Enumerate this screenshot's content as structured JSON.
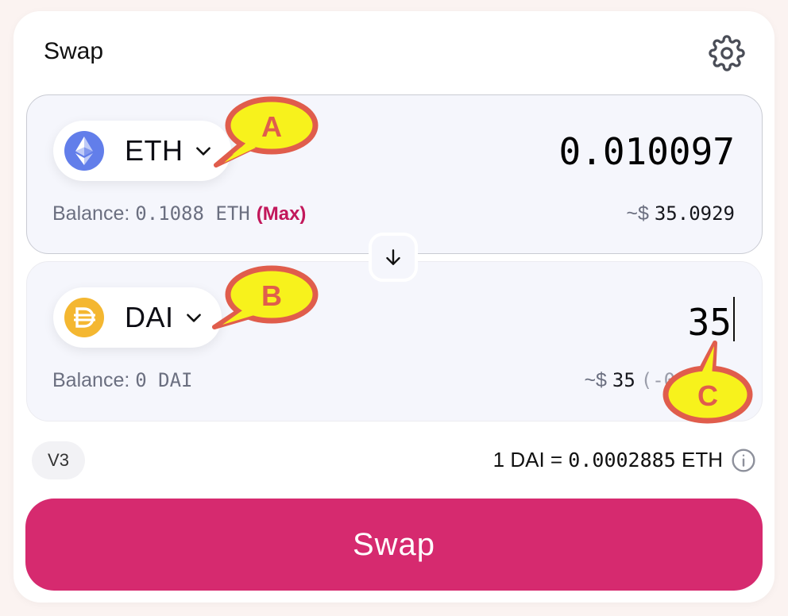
{
  "header": {
    "title": "Swap",
    "settings_icon": "gear-icon"
  },
  "from": {
    "token_symbol": "ETH",
    "token_icon": "ethereum-icon",
    "amount": "0.010097",
    "balance_label": "Balance: ",
    "balance_value": "0.1088 ETH",
    "max_label": "(Max)",
    "usd_prefix": "~$ ",
    "usd_value": "35.0929"
  },
  "to": {
    "token_symbol": "DAI",
    "token_icon": "dai-icon",
    "amount": "35",
    "balance_label": "Balance: ",
    "balance_value": "0 DAI",
    "usd_prefix": "~$ ",
    "usd_value": "35",
    "usd_change": "(-0.0"
  },
  "flip_icon": "arrow-down-icon",
  "footer": {
    "version": "V3",
    "rate_prefix": "1 DAI = ",
    "rate_value": "0.0002885",
    "rate_suffix": " ETH",
    "info_icon": "info-icon"
  },
  "swap_button_label": "Swap",
  "annotations": [
    {
      "label": "A"
    },
    {
      "label": "B"
    },
    {
      "label": "C"
    }
  ],
  "colors": {
    "accent": "#d62a6f",
    "max": "#c2185b",
    "callout_fill": "#f7f21c",
    "callout_stroke": "#e05d4c",
    "eth": "#627eea",
    "dai": "#f4b731"
  }
}
